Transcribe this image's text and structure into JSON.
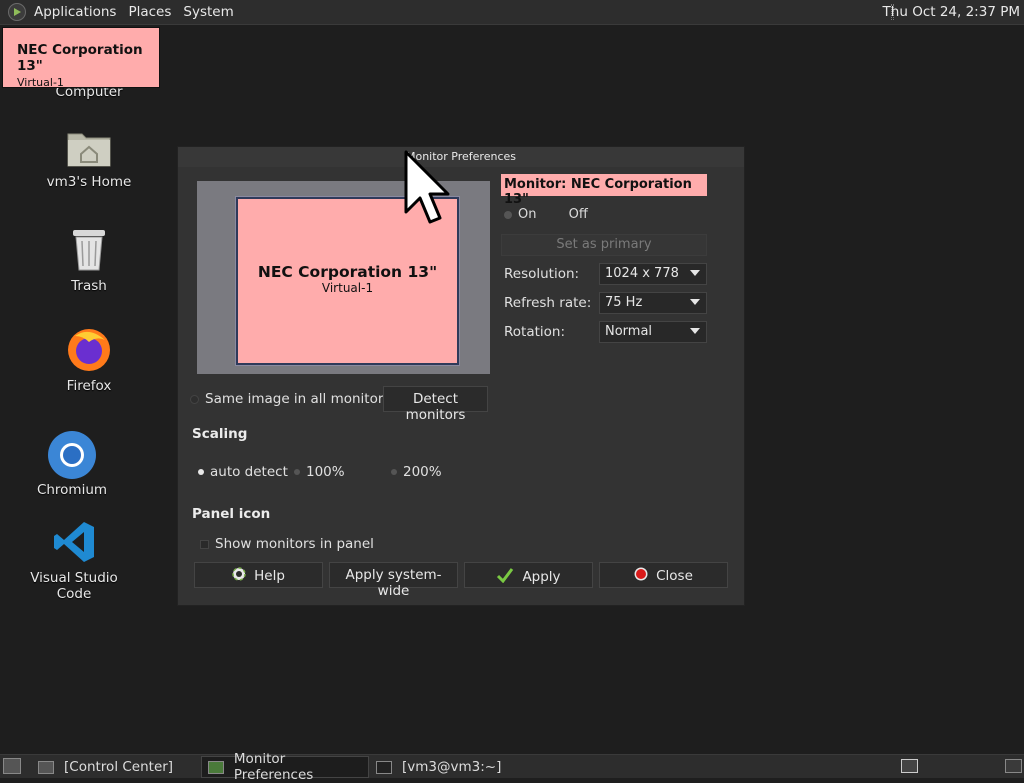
{
  "top_panel": {
    "menu": [
      "Applications",
      "Places",
      "System"
    ],
    "clock": "Thu Oct 24,  2:37 PM"
  },
  "osd": {
    "name": "NEC Corporation 13\"",
    "connector": "Virtual-1"
  },
  "desktop_icons": [
    {
      "label": "Computer",
      "icon": "computer-icon"
    },
    {
      "label": "vm3's Home",
      "icon": "home-folder-icon"
    },
    {
      "label": "Trash",
      "icon": "trash-icon"
    },
    {
      "label": "Firefox",
      "icon": "firefox-icon"
    },
    {
      "label": "Chromium",
      "icon": "chromium-icon"
    },
    {
      "label": "Visual Studio Code",
      "icon": "vscode-icon"
    }
  ],
  "dialog": {
    "title": "Monitor Preferences",
    "preview": {
      "name": "NEC Corporation 13\"",
      "connector": "Virtual-1"
    },
    "monitor_title": "Monitor: NEC Corporation 13\"",
    "on_label": "On",
    "off_label": "Off",
    "set_primary_label": "Set as primary",
    "resolution_label": "Resolution:",
    "resolution_value": "1024 x 778",
    "refresh_label": "Refresh rate:",
    "refresh_value": "75 Hz",
    "rotation_label": "Rotation:",
    "rotation_value": "Normal",
    "same_image_label": "Same image in all monitors",
    "detect_label": "Detect monitors",
    "scaling_title": "Scaling",
    "scaling_options": [
      "auto detect",
      "100%",
      "200%"
    ],
    "panel_icon_title": "Panel icon",
    "show_monitors_label": "Show monitors in panel",
    "buttons": {
      "help": "Help",
      "apply_system": "Apply system-wide",
      "apply": "Apply",
      "close": "Close"
    }
  },
  "taskbar": {
    "tasks": [
      "[Control Center]",
      "Monitor Preferences",
      "[vm3@vm3:~]"
    ]
  },
  "colors": {
    "monitor_fill": "#ffacac",
    "dialog_bg": "#333333",
    "desktop_bg": "#1e1e1e"
  }
}
